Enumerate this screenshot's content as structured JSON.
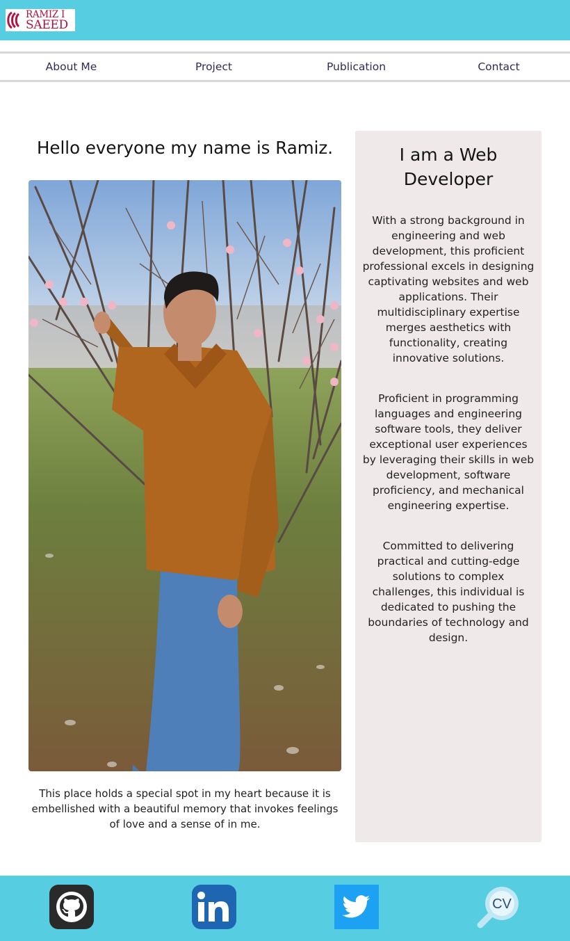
{
  "header": {
    "logo_line1": "RAMIZ I",
    "logo_line2": "SAEED",
    "background_color": "#56cde0"
  },
  "nav": {
    "items": [
      {
        "label": "About Me"
      },
      {
        "label": "Project"
      },
      {
        "label": "Publication"
      },
      {
        "label": "Contact"
      }
    ]
  },
  "main": {
    "title": "Hello everyone my name is Ramiz.",
    "photo_icon": "portrait-photo",
    "caption": "This place holds a special spot in my heart because it is embellished with a beautiful memory that invokes feelings of love and a sense of in me."
  },
  "aside": {
    "heading": "I am a Web Developer",
    "paragraphs": [
      "With a strong background in engineering and web development, this proficient professional excels in designing captivating websites and web applications. Their multidisciplinary expertise merges aesthetics with functionality, creating innovative solutions.",
      "Proficient in programming languages and engineering software tools, they deliver exceptional user experiences by leveraging their skills in web development, software proficiency, and mechanical engineering expertise.",
      "Committed to delivering practical and cutting-edge solutions to complex challenges, this individual is dedicated to pushing the boundaries of technology and design."
    ],
    "background_color": "#efe9e9"
  },
  "footer": {
    "icons": [
      "github-icon",
      "linkedin-icon",
      "twitter-icon",
      "cv-search-icon"
    ],
    "cv_label": "CV",
    "background_color": "#56cde0"
  }
}
